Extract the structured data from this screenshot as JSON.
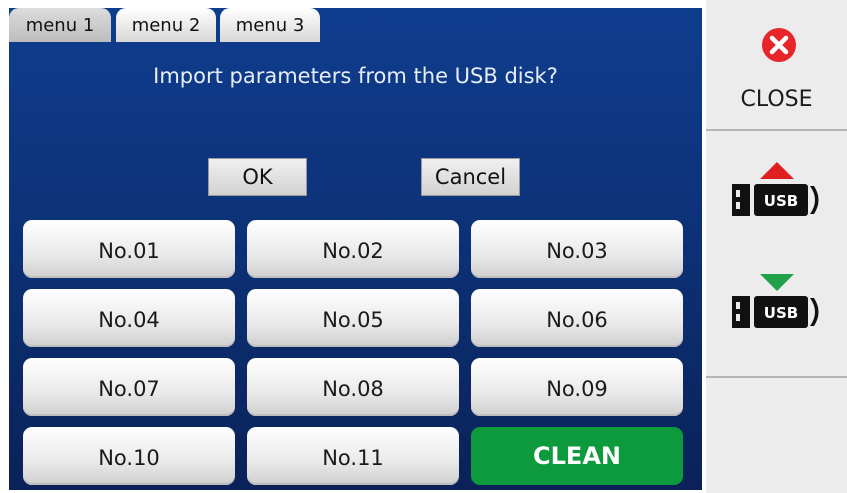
{
  "tabs": [
    "menu 1",
    "menu 2",
    "menu 3"
  ],
  "dialog": {
    "message": "Import parameters from the USB disk?",
    "ok_label": "OK",
    "cancel_label": "Cancel"
  },
  "presets": [
    "No.01",
    "No.02",
    "No.03",
    "No.04",
    "No.05",
    "No.06",
    "No.07",
    "No.08",
    "No.09",
    "No.10",
    "No.11"
  ],
  "clean_label": "CLEAN",
  "sidebar": {
    "close_label": "CLOSE",
    "usb_import_text": "USB",
    "usb_export_text": "USB"
  },
  "colors": {
    "panel_blue": "#0c2f73",
    "close_red": "#e8262a",
    "import_arrow": "#e02020",
    "export_arrow": "#21a24a",
    "clean_green": "#0c9a3c"
  },
  "icons": [
    "close-icon",
    "usb-import-icon",
    "usb-export-icon"
  ]
}
